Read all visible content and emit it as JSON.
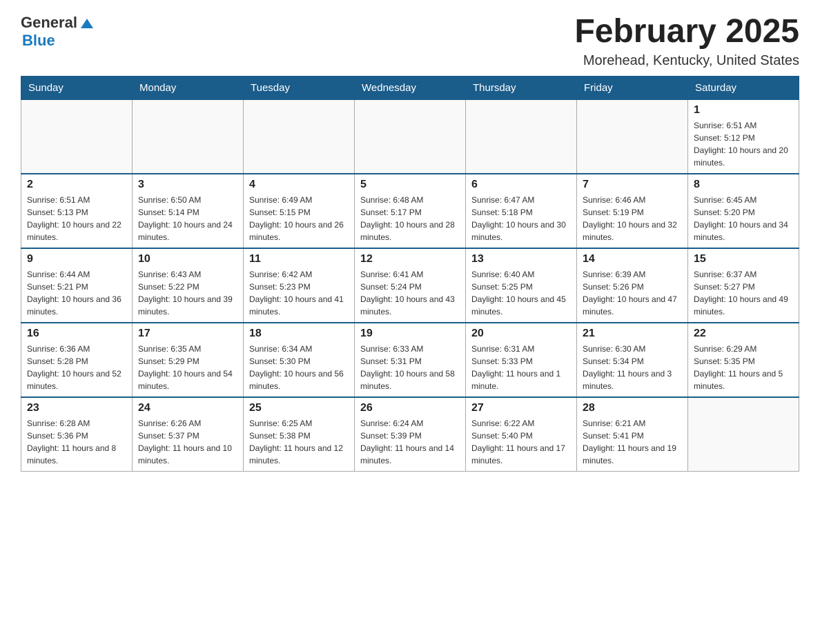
{
  "logo": {
    "general": "General",
    "blue": "Blue"
  },
  "header": {
    "month": "February 2025",
    "location": "Morehead, Kentucky, United States"
  },
  "weekdays": [
    "Sunday",
    "Monday",
    "Tuesday",
    "Wednesday",
    "Thursday",
    "Friday",
    "Saturday"
  ],
  "weeks": [
    [
      {
        "day": "",
        "info": ""
      },
      {
        "day": "",
        "info": ""
      },
      {
        "day": "",
        "info": ""
      },
      {
        "day": "",
        "info": ""
      },
      {
        "day": "",
        "info": ""
      },
      {
        "day": "",
        "info": ""
      },
      {
        "day": "1",
        "info": "Sunrise: 6:51 AM\nSunset: 5:12 PM\nDaylight: 10 hours and 20 minutes."
      }
    ],
    [
      {
        "day": "2",
        "info": "Sunrise: 6:51 AM\nSunset: 5:13 PM\nDaylight: 10 hours and 22 minutes."
      },
      {
        "day": "3",
        "info": "Sunrise: 6:50 AM\nSunset: 5:14 PM\nDaylight: 10 hours and 24 minutes."
      },
      {
        "day": "4",
        "info": "Sunrise: 6:49 AM\nSunset: 5:15 PM\nDaylight: 10 hours and 26 minutes."
      },
      {
        "day": "5",
        "info": "Sunrise: 6:48 AM\nSunset: 5:17 PM\nDaylight: 10 hours and 28 minutes."
      },
      {
        "day": "6",
        "info": "Sunrise: 6:47 AM\nSunset: 5:18 PM\nDaylight: 10 hours and 30 minutes."
      },
      {
        "day": "7",
        "info": "Sunrise: 6:46 AM\nSunset: 5:19 PM\nDaylight: 10 hours and 32 minutes."
      },
      {
        "day": "8",
        "info": "Sunrise: 6:45 AM\nSunset: 5:20 PM\nDaylight: 10 hours and 34 minutes."
      }
    ],
    [
      {
        "day": "9",
        "info": "Sunrise: 6:44 AM\nSunset: 5:21 PM\nDaylight: 10 hours and 36 minutes."
      },
      {
        "day": "10",
        "info": "Sunrise: 6:43 AM\nSunset: 5:22 PM\nDaylight: 10 hours and 39 minutes."
      },
      {
        "day": "11",
        "info": "Sunrise: 6:42 AM\nSunset: 5:23 PM\nDaylight: 10 hours and 41 minutes."
      },
      {
        "day": "12",
        "info": "Sunrise: 6:41 AM\nSunset: 5:24 PM\nDaylight: 10 hours and 43 minutes."
      },
      {
        "day": "13",
        "info": "Sunrise: 6:40 AM\nSunset: 5:25 PM\nDaylight: 10 hours and 45 minutes."
      },
      {
        "day": "14",
        "info": "Sunrise: 6:39 AM\nSunset: 5:26 PM\nDaylight: 10 hours and 47 minutes."
      },
      {
        "day": "15",
        "info": "Sunrise: 6:37 AM\nSunset: 5:27 PM\nDaylight: 10 hours and 49 minutes."
      }
    ],
    [
      {
        "day": "16",
        "info": "Sunrise: 6:36 AM\nSunset: 5:28 PM\nDaylight: 10 hours and 52 minutes."
      },
      {
        "day": "17",
        "info": "Sunrise: 6:35 AM\nSunset: 5:29 PM\nDaylight: 10 hours and 54 minutes."
      },
      {
        "day": "18",
        "info": "Sunrise: 6:34 AM\nSunset: 5:30 PM\nDaylight: 10 hours and 56 minutes."
      },
      {
        "day": "19",
        "info": "Sunrise: 6:33 AM\nSunset: 5:31 PM\nDaylight: 10 hours and 58 minutes."
      },
      {
        "day": "20",
        "info": "Sunrise: 6:31 AM\nSunset: 5:33 PM\nDaylight: 11 hours and 1 minute."
      },
      {
        "day": "21",
        "info": "Sunrise: 6:30 AM\nSunset: 5:34 PM\nDaylight: 11 hours and 3 minutes."
      },
      {
        "day": "22",
        "info": "Sunrise: 6:29 AM\nSunset: 5:35 PM\nDaylight: 11 hours and 5 minutes."
      }
    ],
    [
      {
        "day": "23",
        "info": "Sunrise: 6:28 AM\nSunset: 5:36 PM\nDaylight: 11 hours and 8 minutes."
      },
      {
        "day": "24",
        "info": "Sunrise: 6:26 AM\nSunset: 5:37 PM\nDaylight: 11 hours and 10 minutes."
      },
      {
        "day": "25",
        "info": "Sunrise: 6:25 AM\nSunset: 5:38 PM\nDaylight: 11 hours and 12 minutes."
      },
      {
        "day": "26",
        "info": "Sunrise: 6:24 AM\nSunset: 5:39 PM\nDaylight: 11 hours and 14 minutes."
      },
      {
        "day": "27",
        "info": "Sunrise: 6:22 AM\nSunset: 5:40 PM\nDaylight: 11 hours and 17 minutes."
      },
      {
        "day": "28",
        "info": "Sunrise: 6:21 AM\nSunset: 5:41 PM\nDaylight: 11 hours and 19 minutes."
      },
      {
        "day": "",
        "info": ""
      }
    ]
  ]
}
